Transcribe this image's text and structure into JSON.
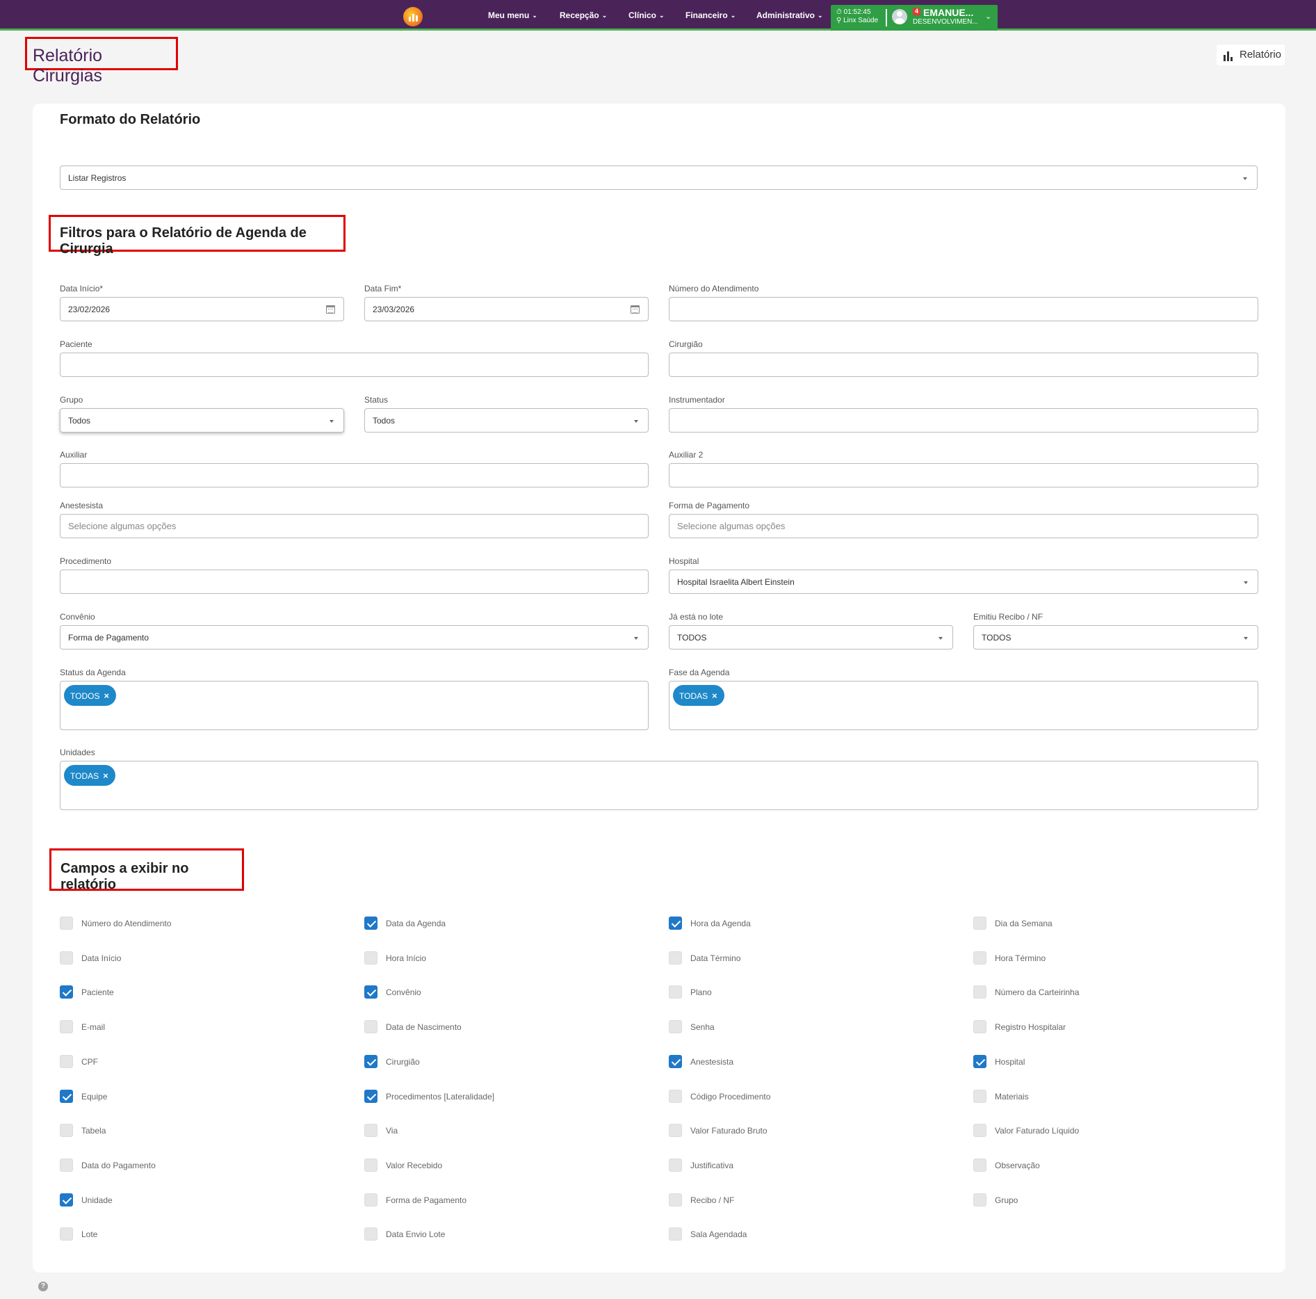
{
  "nav": {
    "items": [
      "Meu menu",
      "Recepção",
      "Clínico",
      "Financeiro",
      "Administrativo"
    ],
    "time": "01:52:45",
    "location": "Linx Saúde",
    "notifications": "4",
    "user_name": "EMANUE...",
    "user_role": "DESENVOLVIMEN..."
  },
  "page": {
    "title": "Relatório Cirurgias",
    "report_button": "Relatório"
  },
  "formato": {
    "heading": "Formato do Relatório",
    "value": "Listar Registros"
  },
  "filtros": {
    "heading": "Filtros para o Relatório de Agenda de Cirurgia",
    "data_inicio_label": "Data Início*",
    "data_inicio": "23/02/2026",
    "data_fim_label": "Data Fim*",
    "data_fim": "23/03/2026",
    "numero_label": "Número do Atendimento",
    "numero": "",
    "paciente_label": "Paciente",
    "paciente": "",
    "cirurgiao_label": "Cirurgião",
    "cirurgiao": "",
    "grupo_label": "Grupo",
    "grupo": "Todos",
    "status_label": "Status",
    "status": "Todos",
    "instrumentador_label": "Instrumentador",
    "instrumentador": "",
    "auxiliar_label": "Auxiliar",
    "auxiliar": "",
    "auxiliar2_label": "Auxiliar 2",
    "auxiliar2": "",
    "anestesista_label": "Anestesista",
    "anestesista_placeholder": "Selecione algumas opções",
    "forma_pagamento_label": "Forma de Pagamento",
    "forma_pagamento_placeholder": "Selecione algumas opções",
    "procedimento_label": "Procedimento",
    "procedimento": "",
    "hospital_label": "Hospital",
    "hospital": "Hospital Israelita Albert Einstein",
    "convenio_label": "Convênio",
    "convenio": "Forma de Pagamento",
    "lote_label": "Já está no lote",
    "lote": "TODOS",
    "recibo_label": "Emitiu Recibo / NF",
    "recibo": "TODOS",
    "status_agenda_label": "Status da Agenda",
    "status_agenda_tag": "TODOS",
    "fase_agenda_label": "Fase da Agenda",
    "fase_agenda_tag": "TODAS",
    "unidades_label": "Unidades",
    "unidades_tag": "TODAS",
    "tag_remove": "×"
  },
  "campos": {
    "heading": "Campos a exibir no relatório",
    "columns": [
      [
        {
          "label": "Número do Atendimento",
          "checked": false
        },
        {
          "label": "Data Início",
          "checked": false
        },
        {
          "label": "Paciente",
          "checked": true
        },
        {
          "label": "E-mail",
          "checked": false
        },
        {
          "label": "CPF",
          "checked": false
        },
        {
          "label": "Equipe",
          "checked": true
        },
        {
          "label": "Tabela",
          "checked": false
        },
        {
          "label": "Data do Pagamento",
          "checked": false
        },
        {
          "label": "Unidade",
          "checked": true
        },
        {
          "label": "Lote",
          "checked": false
        }
      ],
      [
        {
          "label": "Data da Agenda",
          "checked": true
        },
        {
          "label": "Hora Início",
          "checked": false
        },
        {
          "label": "Convênio",
          "checked": true
        },
        {
          "label": "Data de Nascimento",
          "checked": false
        },
        {
          "label": "Cirurgião",
          "checked": true
        },
        {
          "label": "Procedimentos [Lateralidade]",
          "checked": true
        },
        {
          "label": "Via",
          "checked": false
        },
        {
          "label": "Valor Recebido",
          "checked": false
        },
        {
          "label": "Forma de Pagamento",
          "checked": false
        },
        {
          "label": "Data Envio Lote",
          "checked": false
        }
      ],
      [
        {
          "label": "Hora da Agenda",
          "checked": true
        },
        {
          "label": "Data Término",
          "checked": false
        },
        {
          "label": "Plano",
          "checked": false
        },
        {
          "label": "Senha",
          "checked": false
        },
        {
          "label": "Anestesista",
          "checked": true
        },
        {
          "label": "Código Procedimento",
          "checked": false
        },
        {
          "label": "Valor Faturado Bruto",
          "checked": false
        },
        {
          "label": "Justificativa",
          "checked": false
        },
        {
          "label": "Recibo / NF",
          "checked": false
        },
        {
          "label": "Sala Agendada",
          "checked": false
        }
      ],
      [
        {
          "label": "Dia da Semana",
          "checked": false
        },
        {
          "label": "Hora Término",
          "checked": false
        },
        {
          "label": "Número da Carteirinha",
          "checked": false
        },
        {
          "label": "Registro Hospitalar",
          "checked": false
        },
        {
          "label": "Hospital",
          "checked": true
        },
        {
          "label": "Materiais",
          "checked": false
        },
        {
          "label": "Valor Faturado Líquido",
          "checked": false
        },
        {
          "label": "Observação",
          "checked": false
        },
        {
          "label": "Grupo",
          "checked": false
        }
      ]
    ]
  },
  "help": "?"
}
